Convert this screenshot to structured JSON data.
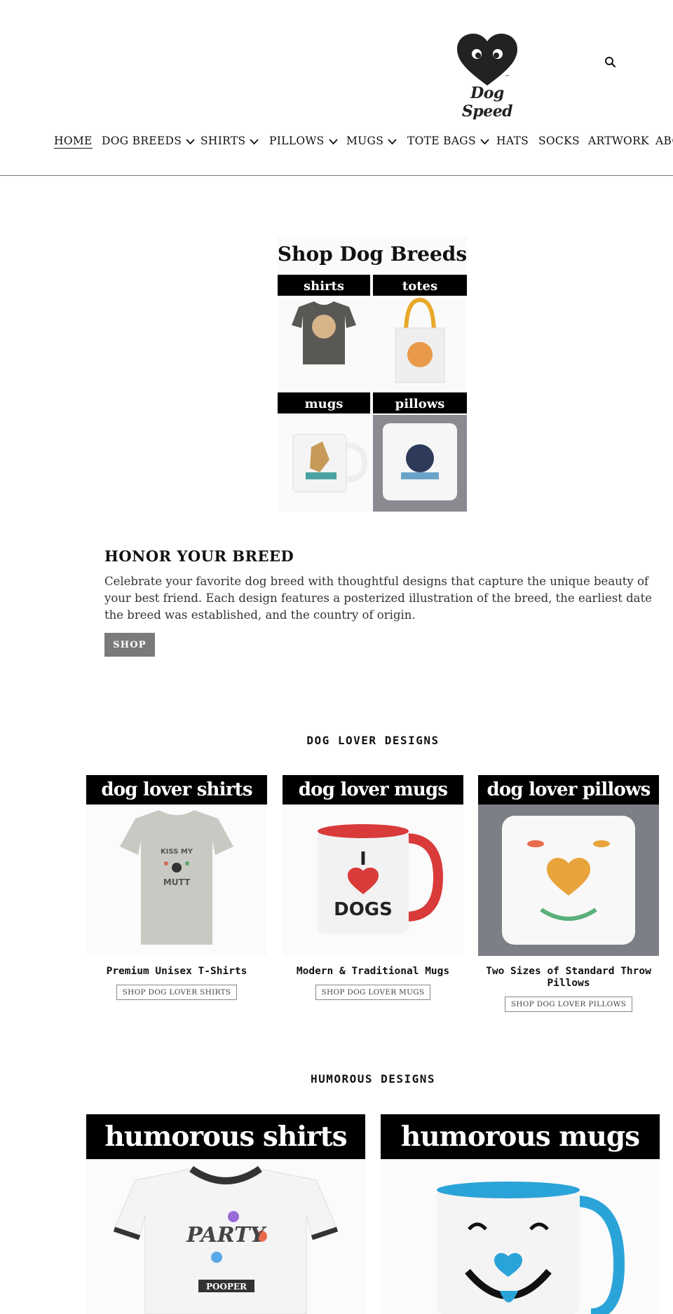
{
  "brand": {
    "name": "Dog Speed",
    "tm": "™"
  },
  "nav": {
    "items": [
      {
        "label": "HOME",
        "dropdown": false,
        "active": true
      },
      {
        "label": "DOG BREEDS",
        "dropdown": true
      },
      {
        "label": "SHIRTS",
        "dropdown": true
      },
      {
        "label": "PILLOWS",
        "dropdown": true
      },
      {
        "label": "MUGS",
        "dropdown": true
      },
      {
        "label": "TOTE BAGS",
        "dropdown": true
      },
      {
        "label": "HATS",
        "dropdown": false
      },
      {
        "label": "SOCKS",
        "dropdown": false
      },
      {
        "label": "ARTWORK",
        "dropdown": false
      },
      {
        "label": "ABO",
        "dropdown": false
      }
    ]
  },
  "hero": {
    "image": {
      "title": "Shop Dog Breeds",
      "labels": [
        "shirts",
        "totes",
        "mugs",
        "pillows"
      ]
    },
    "heading": "HONOR YOUR BREED",
    "text": "Celebrate your favorite dog breed with thoughtful designs that capture the unique beauty of your best friend. Each design features a posterized illustration of the breed, the earliest date the breed was established, and the country of origin.",
    "button": "SHOP"
  },
  "dog_lover": {
    "title": "DOG LOVER DESIGNS",
    "cards": [
      {
        "banner": "dog lover shirts",
        "title": "Premium Unisex T-Shirts",
        "button": "SHOP DOG LOVER SHIRTS",
        "shirt_text": [
          "KISS MY",
          "MUTT"
        ]
      },
      {
        "banner": "dog lover mugs",
        "title": "Modern & Traditional Mugs",
        "button": "SHOP DOG LOVER MUGS",
        "mug_text": [
          "I",
          "DOGS"
        ]
      },
      {
        "banner": "dog lover pillows",
        "title": "Two Sizes of Standard Throw Pillows",
        "button": "SHOP DOG LOVER PILLOWS"
      }
    ]
  },
  "humorous": {
    "title": "HUMOROUS DESIGNS",
    "cards": [
      {
        "banner": "humorous shirts",
        "shirt_text": [
          "PARTY",
          "POOPER"
        ]
      },
      {
        "banner": "humorous mugs"
      }
    ]
  },
  "colors": {
    "nav_text": "#111111",
    "button_bg": "#7a7a7a",
    "banner_bg": "#000000",
    "mug_red": "#d93a3a",
    "mug_blue": "#2aa3d8"
  }
}
